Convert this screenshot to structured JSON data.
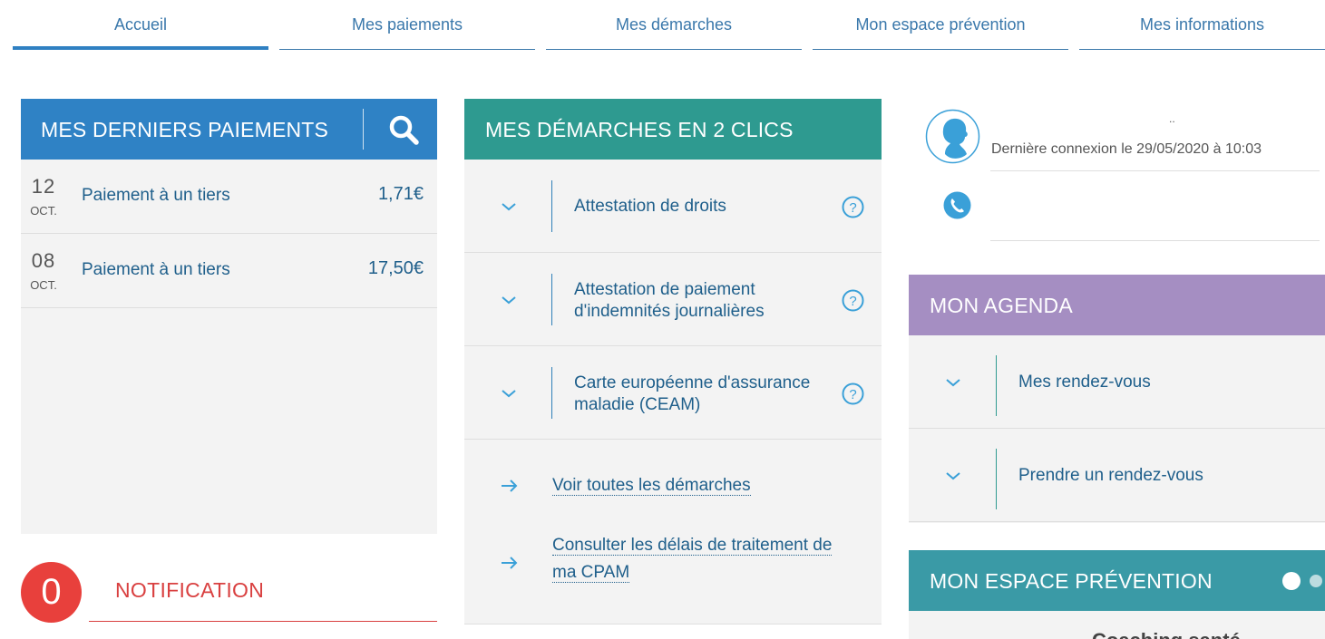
{
  "nav": {
    "tabs": [
      {
        "label": "Accueil"
      },
      {
        "label": "Mes paiements"
      },
      {
        "label": "Mes démarches"
      },
      {
        "label": "Mon espace prévention"
      },
      {
        "label": "Mes informations"
      }
    ],
    "active": "Accueil"
  },
  "payments": {
    "title": "MES DERNIERS PAIEMENTS",
    "search_icon": "search-icon",
    "items": [
      {
        "day": "12",
        "month": "OCT.",
        "label": "Paiement à un tiers",
        "amount": "1,71€"
      },
      {
        "day": "08",
        "month": "OCT.",
        "label": "Paiement à un tiers",
        "amount": "17,50€"
      }
    ]
  },
  "notification": {
    "count": "0",
    "label": "NOTIFICATION"
  },
  "demarches": {
    "title": "MES DÉMARCHES EN 2 CLICS",
    "items": [
      {
        "label": "Attestation de droits"
      },
      {
        "label": "Attestation de paiement d'indemnités journalières"
      },
      {
        "label": "Carte européenne d'assurance maladie (CEAM)"
      }
    ],
    "links": [
      {
        "label": "Voir toutes les démarches"
      },
      {
        "label": "Consulter les délais de traitement de ma CPAM"
      }
    ]
  },
  "profile": {
    "name": "..",
    "last_connection": "Dernière connexion le 29/05/2020 à 10:03",
    "avatar_icon": "user-avatar-icon",
    "phone_icon": "phone-icon"
  },
  "agenda": {
    "title": "MON AGENDA",
    "items": [
      {
        "label": "Mes rendez-vous"
      },
      {
        "label": "Prendre un rendez-vous"
      }
    ]
  },
  "prevention": {
    "title": "MON ESPACE PRÉVENTION",
    "subtitle": "Coaching santé"
  },
  "colors": {
    "payments_header": "#2f82c5",
    "demarches_header": "#2e9a90",
    "agenda_header": "#a58ec2",
    "prevention_header": "#3a9aa6",
    "notification": "#e8403c",
    "link_text": "#1f5f8b"
  }
}
